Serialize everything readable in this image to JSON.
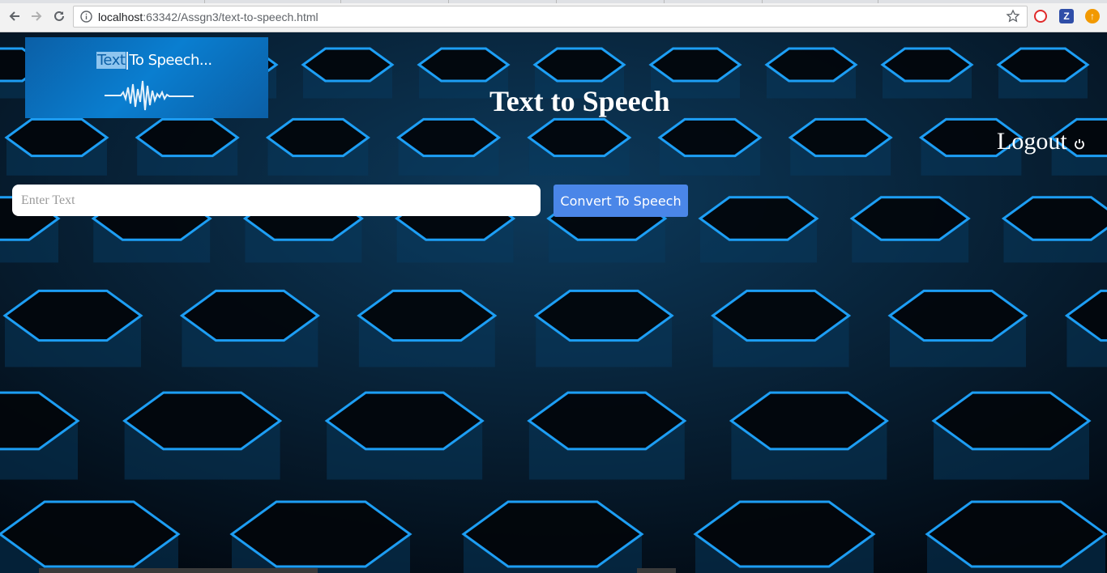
{
  "browser": {
    "url_host": "localhost",
    "url_rest": ":63342/Assgn3/text-to-speech.html",
    "extensions": [
      {
        "name": "opera-icon",
        "color": "#e02a2a",
        "glyph": "O"
      },
      {
        "name": "zotero-icon",
        "color": "#2f4ea8",
        "glyph": "Z"
      },
      {
        "name": "update-icon",
        "color": "#f29900",
        "glyph": "↑"
      }
    ]
  },
  "header": {
    "logo_text_highlight": "Text",
    "logo_text_rest": "To Speech...",
    "title": "Text to Speech",
    "logout_label": "Logout"
  },
  "form": {
    "input_placeholder": "Enter Text",
    "input_value": "",
    "button_label": "Convert To Speech"
  },
  "colors": {
    "accent": "#4a86e8",
    "glow": "#1fa6ff"
  }
}
